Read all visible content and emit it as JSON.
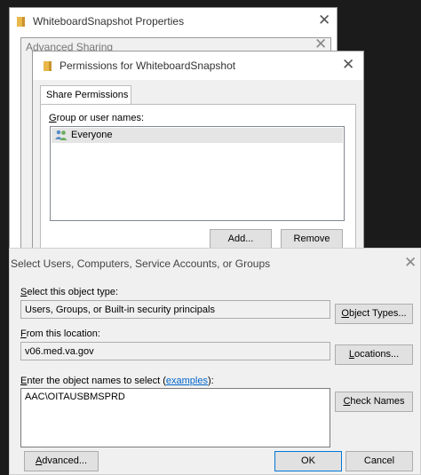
{
  "properties_window": {
    "title": "WhiteboardSnapshot Properties",
    "close": "✕"
  },
  "advanced_sharing": {
    "title": "Advanced Sharing",
    "close": "✕"
  },
  "permissions": {
    "title": "Permissions for WhiteboardSnapshot",
    "close": "✕",
    "tab": "Share Permissions",
    "group_label": "Group or user names:",
    "users": [
      "Everyone"
    ],
    "add_button": "Add...",
    "remove_button": "Remove"
  },
  "select_dialog": {
    "title": "Select Users, Computers, Service Accounts, or Groups",
    "close": "✕",
    "object_type_label": "Select this object type:",
    "object_type_value": "Users, Groups, or Built-in security principals",
    "object_types_button": "Object Types...",
    "location_label": "From this location:",
    "location_value": "v06.med.va.gov",
    "locations_button": "Locations...",
    "names_label_prefix": "Enter the object names to select (",
    "names_label_link": "examples",
    "names_label_suffix": "):",
    "names_value": "AAC\\OITAUSBMSPRD",
    "check_names_button": "Check Names",
    "advanced_button": "Advanced...",
    "ok_button": "OK",
    "cancel_button": "Cancel"
  },
  "colors": {
    "accent": "#0078d7",
    "link": "#0066cc",
    "dialog_bg": "#f0f0f0",
    "folder": "#e8b84a"
  }
}
